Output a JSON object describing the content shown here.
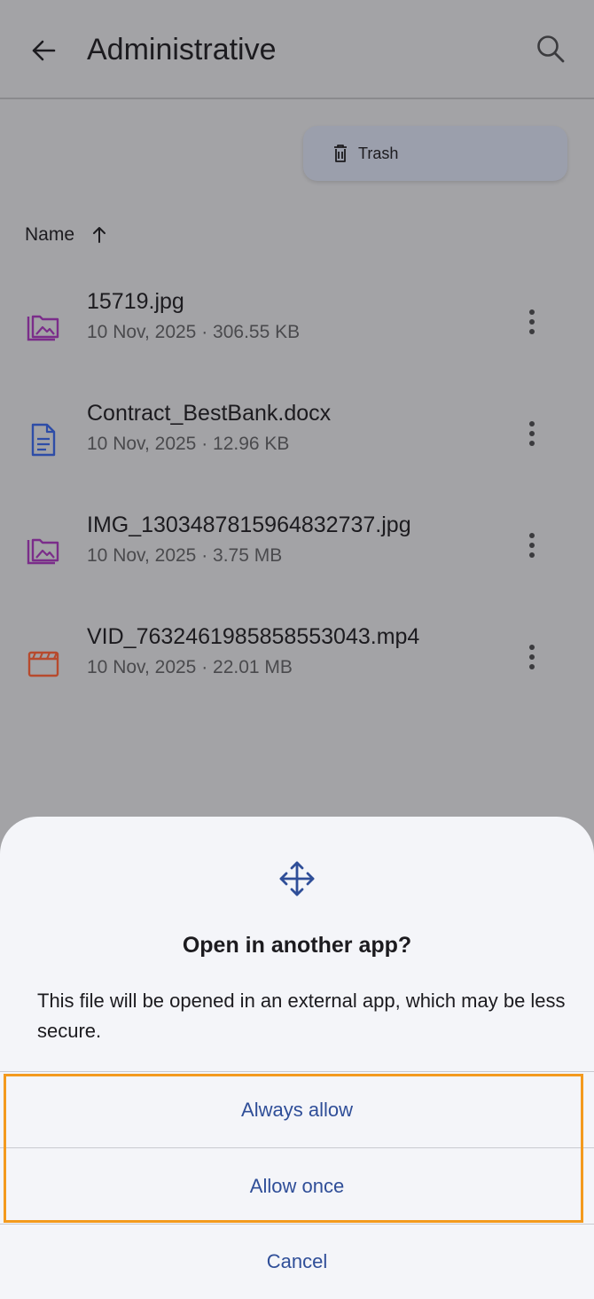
{
  "header": {
    "title": "Administrative",
    "back_icon": "arrow-left-icon",
    "search_icon": "search-icon"
  },
  "toolbar": {
    "trash_label": "Trash",
    "trash_icon": "trash-icon"
  },
  "sort": {
    "label": "Name",
    "direction_icon": "arrow-up-icon"
  },
  "files": [
    {
      "name": "15719.jpg",
      "meta": "10 Nov, 2025 · 306.55 KB",
      "icon": "image-folder-icon",
      "icon_color": "#7b2d8a"
    },
    {
      "name": "Contract_BestBank.docx",
      "meta": "10 Nov, 2025 · 12.96 KB",
      "icon": "document-icon",
      "icon_color": "#2e4da7"
    },
    {
      "name": "IMG_1303487815964832737.jpg",
      "meta": "10 Nov, 2025 · 3.75 MB",
      "icon": "image-folder-icon",
      "icon_color": "#7b2d8a"
    },
    {
      "name": "VID_7632461985858553043.mp4",
      "meta": "10 Nov, 2025 · 22.01 MB",
      "icon": "video-icon",
      "icon_color": "#b74a2d"
    }
  ],
  "dialog": {
    "icon": "move-arrows-icon",
    "title": "Open in another app?",
    "body": "This file will be opened in an external app, which may be less secure.",
    "actions": {
      "always_allow": "Always allow",
      "allow_once": "Allow once",
      "cancel": "Cancel"
    }
  },
  "colors": {
    "accent_text": "#2f4e98",
    "highlight": "#f39a1e",
    "sheet_background": "#f4f5f9",
    "page_background": "#a3a3a6"
  }
}
